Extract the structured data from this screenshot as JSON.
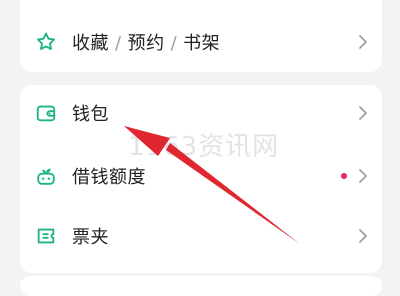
{
  "menu": {
    "top_item": {
      "parts": [
        "收藏",
        "预约",
        "书架"
      ],
      "separator": "/",
      "icon": "star-outline-icon"
    },
    "items": [
      {
        "label": "钱包",
        "icon": "wallet-icon"
      },
      {
        "label": "借钱额度",
        "icon": "sprout-bot-icon",
        "badge_dot": true
      },
      {
        "label": "票夹",
        "icon": "ticket-clip-icon"
      }
    ]
  },
  "watermark": "1163资讯网",
  "colors": {
    "accent": "#19b57a",
    "badge": "#e0245e",
    "arrow": "#e0262f"
  }
}
